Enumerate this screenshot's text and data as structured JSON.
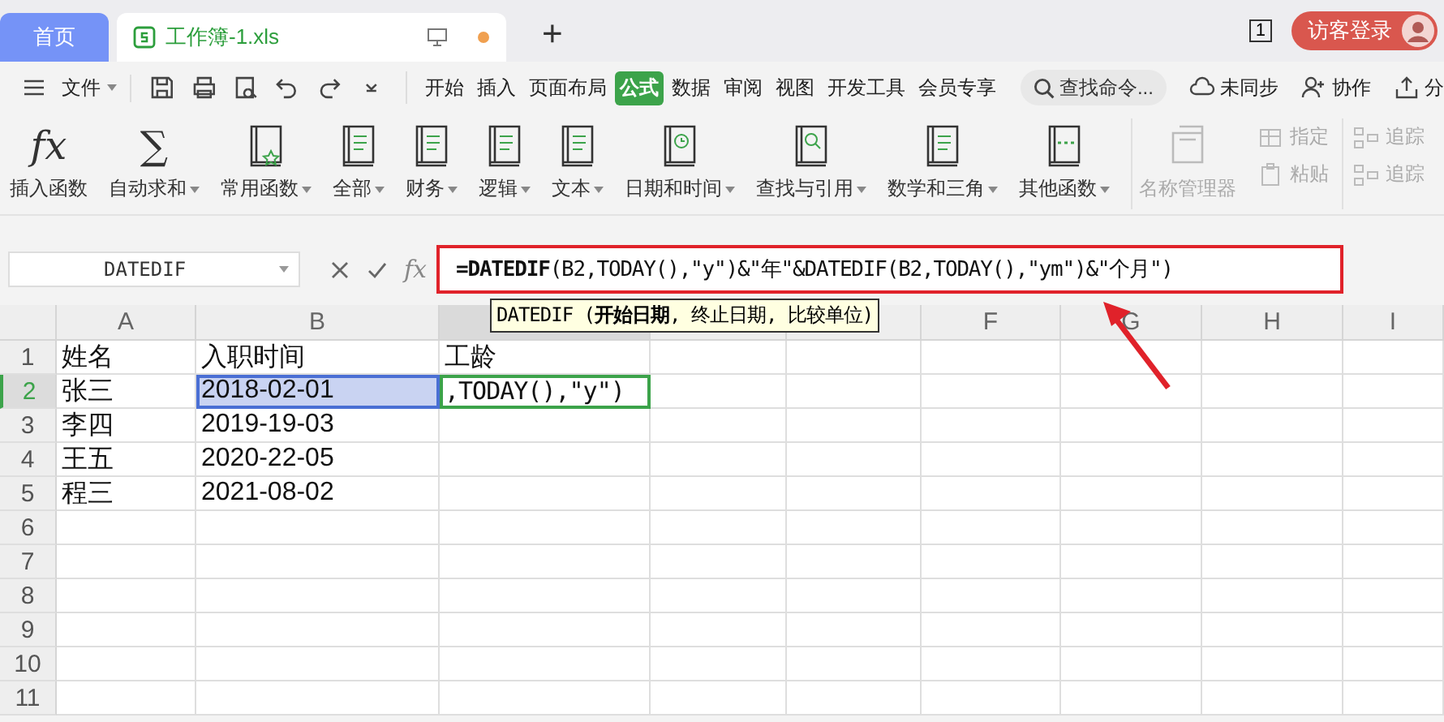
{
  "tab_bar": {
    "tabs": [
      {
        "label": "首页",
        "kind": "home",
        "selected": false
      },
      {
        "label": "工作簿-1.xls",
        "kind": "doc",
        "selected": true
      }
    ],
    "new_tab": "+",
    "page_count": "1",
    "login": "访客登录"
  },
  "menu_bar": {
    "file": "文件",
    "items": [
      {
        "label": "开始",
        "selected": false
      },
      {
        "label": "插入",
        "selected": false
      },
      {
        "label": "页面布局",
        "selected": false
      },
      {
        "label": "公式",
        "selected": true
      },
      {
        "label": "数据",
        "selected": false
      },
      {
        "label": "审阅",
        "selected": false
      },
      {
        "label": "视图",
        "selected": false
      },
      {
        "label": "开发工具",
        "selected": false
      },
      {
        "label": "会员专享",
        "selected": false
      }
    ],
    "search": {
      "placeholder": "查找命令..."
    },
    "right": [
      {
        "label": "未同步",
        "kind": "cloud"
      },
      {
        "label": "协作",
        "kind": "person"
      },
      {
        "label": "分",
        "kind": "share"
      }
    ]
  },
  "ribbon": {
    "functions": [
      {
        "label": "插入函数",
        "kind": "glyph",
        "glyph": "fx",
        "dropdown": false
      },
      {
        "label": "自动求和",
        "kind": "glyph",
        "glyph": "∑",
        "dropdown": true
      },
      {
        "label": "常用函数",
        "kind": "star",
        "dropdown": true
      },
      {
        "label": "全部",
        "kind": "book",
        "dropdown": true
      },
      {
        "label": "财务",
        "kind": "book",
        "dropdown": true
      },
      {
        "label": "逻辑",
        "kind": "book",
        "dropdown": true
      },
      {
        "label": "文本",
        "kind": "book",
        "dropdown": true
      },
      {
        "label": "日期和时间",
        "kind": "clock",
        "dropdown": true
      },
      {
        "label": "查找与引用",
        "kind": "search",
        "dropdown": true
      },
      {
        "label": "数学和三角",
        "kind": "book",
        "dropdown": true
      },
      {
        "label": "其他函数",
        "kind": "dots",
        "dropdown": true
      }
    ],
    "names": {
      "label": "名称管理器",
      "disabled": true
    },
    "small": [
      {
        "label": "指定",
        "disabled": true
      },
      {
        "label": "粘贴",
        "disabled": true
      }
    ],
    "trace": [
      {
        "label": "追踪",
        "disabled": true
      },
      {
        "label": "追踪",
        "disabled": true
      }
    ]
  },
  "formula_bar": {
    "name_box": "DATEDIF",
    "fx": "fx",
    "formula": "**=DATEDIF**(B2,TODAY(),\"y\")&\"年\"&DATEDIF(B2,TODAY(),\"ym\")&\"个月\")"
  },
  "tooltip": "DATEDIF (**开始日期**, 终止日期, 比较单位)",
  "grid": {
    "columns": [
      {
        "label": "A",
        "selected": false
      },
      {
        "label": "B",
        "selected": false
      },
      {
        "selected": true
      },
      {
        "selected": false
      },
      {
        "selected": false
      },
      {
        "label": "F",
        "selected": false
      },
      {
        "label": "G",
        "selected": false
      },
      {
        "label": "H",
        "selected": false
      },
      {
        "label": "I",
        "selected": false
      }
    ],
    "rows": [
      {
        "number": "1",
        "selected": false,
        "cells": [
          {
            "text": "姓名",
            "selected": false,
            "editing": false
          },
          {
            "text": "入职时间",
            "selected": false,
            "editing": false
          },
          {
            "text": "工龄",
            "selected": false,
            "editing": false
          }
        ]
      },
      {
        "number": "2",
        "selected": true,
        "cells": [
          {
            "text": "张三",
            "selected": false,
            "editing": false
          },
          {
            "text": "2018-02-01",
            "selected": true,
            "editing": false
          },
          {
            "text": ",TODAY(),\"y\")",
            "selected": false,
            "editing": true
          }
        ]
      },
      {
        "number": "3",
        "selected": false,
        "cells": [
          {
            "text": "李四",
            "selected": false,
            "editing": false
          },
          {
            "text": "2019-19-03",
            "selected": false,
            "editing": false
          }
        ]
      },
      {
        "number": "4",
        "selected": false,
        "cells": [
          {
            "text": "王五",
            "selected": false,
            "editing": false
          },
          {
            "text": "2020-22-05",
            "selected": false,
            "editing": false
          }
        ]
      },
      {
        "number": "5",
        "selected": false,
        "cells": [
          {
            "text": "程三",
            "selected": false,
            "editing": false
          },
          {
            "text": "2021-08-02",
            "selected": false,
            "editing": false
          }
        ]
      },
      {
        "number": "6",
        "selected": false,
        "cells": []
      },
      {
        "number": "7",
        "selected": false,
        "cells": []
      },
      {
        "number": "8",
        "selected": false,
        "cells": []
      },
      {
        "number": "9",
        "selected": false,
        "cells": []
      },
      {
        "number": "10",
        "selected": false,
        "cells": []
      },
      {
        "number": "11",
        "selected": false,
        "cells": []
      }
    ]
  }
}
